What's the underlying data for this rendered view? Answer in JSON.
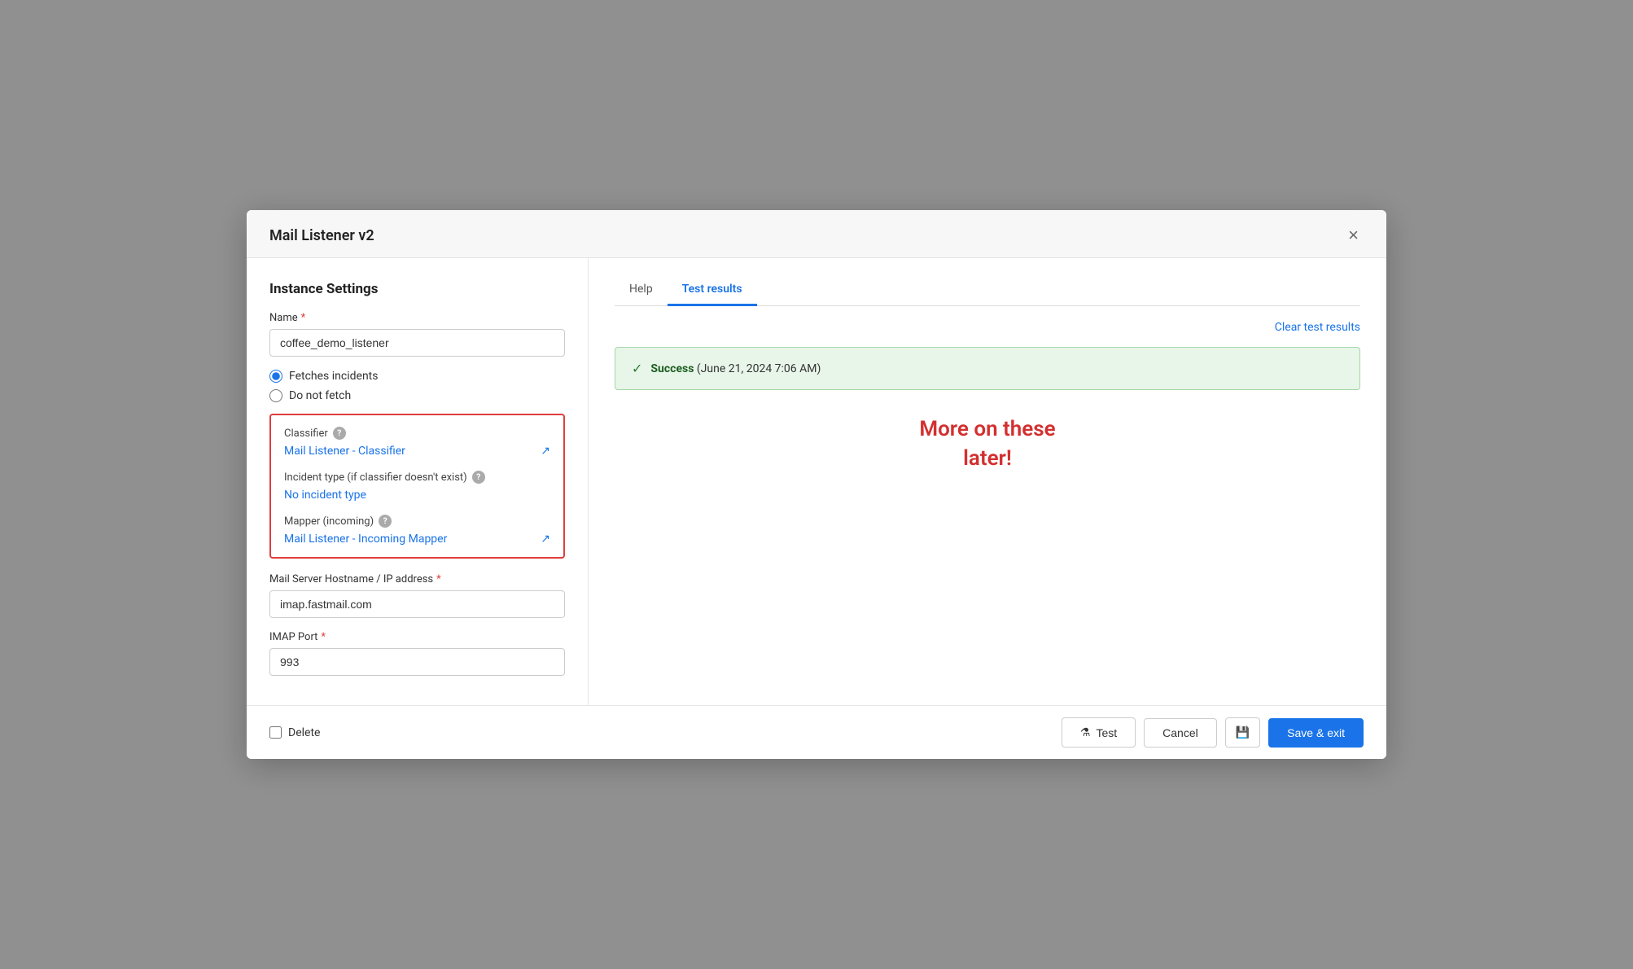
{
  "modal": {
    "title": "Mail Listener v2",
    "close_label": "×"
  },
  "left": {
    "section_title": "Instance Settings",
    "name_label": "Name",
    "name_value": "coffee_demo_listener",
    "name_placeholder": "Name",
    "radio_options": [
      {
        "label": "Fetches incidents",
        "value": "fetches",
        "checked": true
      },
      {
        "label": "Do not fetch",
        "value": "no-fetch",
        "checked": false
      }
    ],
    "classifier_section": {
      "classifier_label": "Classifier",
      "classifier_value": "Mail Listener - Classifier",
      "incident_type_label": "Incident type (if classifier doesn't exist)",
      "incident_type_value": "No incident type",
      "mapper_label": "Mapper (incoming)",
      "mapper_value": "Mail Listener - Incoming Mapper"
    },
    "mail_server_label": "Mail Server Hostname / IP address",
    "mail_server_required": true,
    "mail_server_value": "imap.fastmail.com",
    "imap_port_label": "IMAP Port",
    "imap_port_required": true,
    "imap_port_value": "993"
  },
  "right": {
    "tabs": [
      {
        "label": "Help",
        "active": false
      },
      {
        "label": "Test results",
        "active": true
      }
    ],
    "clear_label": "Clear test results",
    "success_message": "Success",
    "success_date": "(June 21, 2024 7:06 AM)",
    "more_on_these_text": "More on these\nlater!"
  },
  "footer": {
    "delete_label": "Delete",
    "test_label": "Test",
    "cancel_label": "Cancel",
    "save_exit_label": "Save & exit"
  }
}
